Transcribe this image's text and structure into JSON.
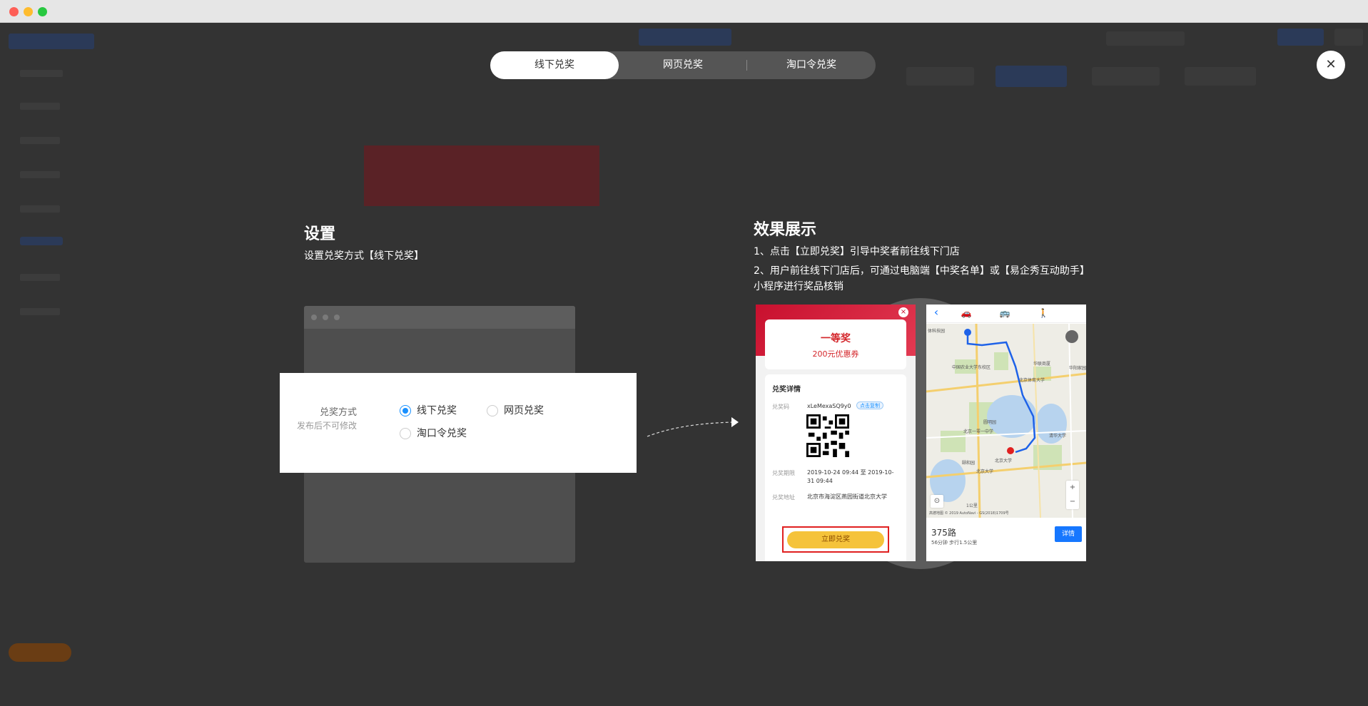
{
  "tabs": [
    {
      "label": "线下兑奖",
      "active": true
    },
    {
      "label": "网页兑奖",
      "active": false
    },
    {
      "label": "淘口令兑奖",
      "active": false
    }
  ],
  "close_label": "✕",
  "settings": {
    "title": "设置",
    "subtitle": "设置兑奖方式【线下兑奖】",
    "field_label": "兑奖方式",
    "field_hint": "发布后不可修改",
    "options": [
      {
        "label": "线下兑奖",
        "checked": true
      },
      {
        "label": "网页兑奖",
        "checked": false
      },
      {
        "label": "淘口令兑奖",
        "checked": false
      }
    ]
  },
  "preview": {
    "title": "效果展示",
    "line1": "1、点击【立即兑奖】引导中奖者前往线下门店",
    "line2": "2、用户前往线下门店后，可通过电脑端【中奖名单】或【易企秀互动助手】小程序进行奖品核销"
  },
  "phone1": {
    "close": "×",
    "prize_title": "一等奖",
    "prize_sub": "200元优惠券",
    "detail_title": "兑奖详情",
    "code_label": "兑奖码",
    "code_value": "xLeMexaSQ9y0",
    "copy_label": "点击复制",
    "period_label": "兑奖期限",
    "period_value": "2019-10-24 09:44 至 2019-10-31 09:44",
    "address_label": "兑奖地址",
    "address_value": "北京市海淀区燕园街道北京大学",
    "redeem_label": "立即兑奖"
  },
  "phone2": {
    "back_icon": "‹",
    "car_icon": "🚗",
    "bus_icon": "🚌",
    "walk_icon": "🚶",
    "labels": {
      "l1": "体科技园",
      "l2": "中国农业大学东校区",
      "l3": "华联商厦",
      "l4": "北京体育大学",
      "l5": "华阳家园",
      "l6": "清华大学",
      "l7": "北京大学",
      "l8": "圆明园",
      "l9": "北京一零一中学",
      "l10": "颐和园",
      "l11": "北京大学",
      "scale": "1公里",
      "copyright": "高德地图 © 2019 AutoNavi - GS(2018)1709号"
    },
    "zoom_in": "+",
    "zoom_out": "−",
    "locate_icon": "⊙",
    "route_name": "375路",
    "route_info": "56分钟 步行1.5公里",
    "detail_label": "详情"
  },
  "colors": {
    "accent": "#1890ff",
    "prize_red": "#d4262b",
    "redeem_yellow": "#f5c33b",
    "route_blue": "#1677ff"
  }
}
